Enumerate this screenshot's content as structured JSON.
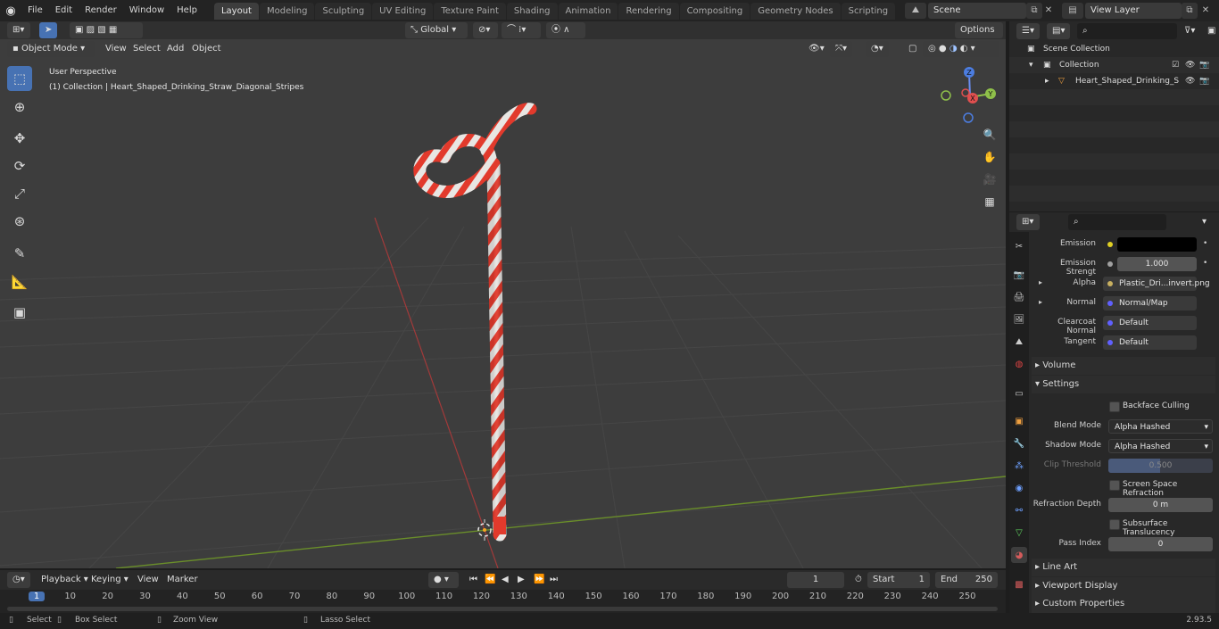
{
  "menu": [
    "File",
    "Edit",
    "Render",
    "Window",
    "Help"
  ],
  "workspaces": [
    "Layout",
    "Modeling",
    "Sculpting",
    "UV Editing",
    "Texture Paint",
    "Shading",
    "Animation",
    "Rendering",
    "Compositing",
    "Geometry Nodes",
    "Scripting"
  ],
  "scene": {
    "name": "Scene",
    "view_layer": "View Layer"
  },
  "header": {
    "transform": "Global",
    "options": "Options"
  },
  "viewport_header": {
    "mode": "Object Mode",
    "view": "View",
    "select": "Select",
    "add": "Add",
    "object": "Object"
  },
  "viewport": {
    "perspective": "User Perspective",
    "collection_label": "(1) Collection | Heart_Shaped_Drinking_Straw_Diagonal_Stripes"
  },
  "gizmo": {
    "x": "X",
    "y": "Y",
    "z": "Z"
  },
  "outliner": {
    "scene_collection": "Scene Collection",
    "collection": "Collection",
    "object": "Heart_Shaped_Drinking_S"
  },
  "properties": {
    "emission_label": "Emission",
    "emission_strength_label": "Emission Strengt",
    "emission_strength": "1.000",
    "alpha_label": "Alpha",
    "alpha_value": "Plastic_Dri...invert.png",
    "normal_label": "Normal",
    "normal_value": "Normal/Map",
    "clearcoat_label": "Clearcoat Normal",
    "clearcoat_value": "Default",
    "tangent_label": "Tangent",
    "tangent_value": "Default",
    "volume": "Volume",
    "settings": "Settings",
    "backface": "Backface Culling",
    "blend_mode_label": "Blend Mode",
    "blend_mode": "Alpha Hashed",
    "shadow_mode_label": "Shadow Mode",
    "shadow_mode": "Alpha Hashed",
    "clip_label": "Clip Threshold",
    "clip_value": "0.500",
    "ssr": "Screen Space Refraction",
    "refraction_label": "Refraction Depth",
    "refraction_value": "0 m",
    "subsurface": "Subsurface Translucency",
    "pass_label": "Pass Index",
    "pass_value": "0",
    "line_art": "Line Art",
    "viewport_display": "Viewport Display",
    "custom_properties": "Custom Properties"
  },
  "timeline": {
    "playback": "Playback",
    "keying": "Keying",
    "view": "View",
    "marker": "Marker",
    "current_frame": "1",
    "start_label": "Start",
    "start": "1",
    "end_label": "End",
    "end": "250",
    "ticks": [
      "1",
      "10",
      "20",
      "30",
      "40",
      "50",
      "60",
      "70",
      "80",
      "90",
      "100",
      "110",
      "120",
      "130",
      "140",
      "150",
      "160",
      "170",
      "180",
      "190",
      "200",
      "210",
      "220",
      "230",
      "240",
      "250"
    ]
  },
  "status": {
    "select": "Select",
    "box_select": "Box Select",
    "zoom_view": "Zoom View",
    "lasso_select": "Lasso Select",
    "version": "2.93.5"
  }
}
